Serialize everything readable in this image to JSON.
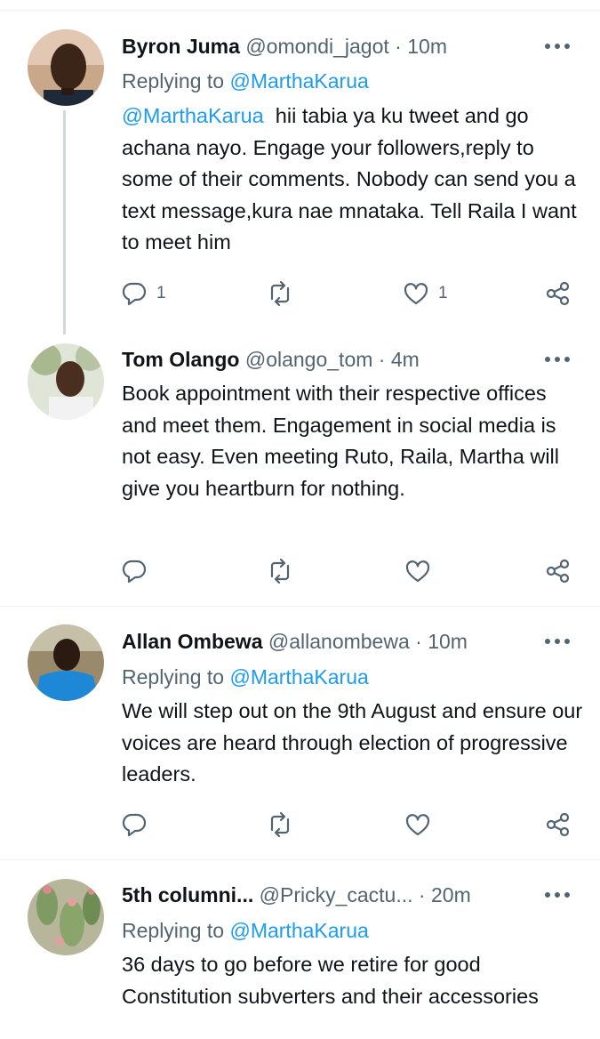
{
  "theme": {
    "accent": "#1d9bf0",
    "muted": "#536471",
    "text": "#0f1419",
    "divider": "#eff3f4"
  },
  "tweets": [
    {
      "name": "Byron Juma",
      "handle": "@omondi_jagot",
      "time": "10m",
      "separator": "·",
      "replying_label": "Replying to",
      "replying_to": "@MarthaKarua",
      "mention": "@MarthaKarua",
      "text": "hii tabia ya ku tweet and go achana nayo. Engage your followers,reply to some of their comments.  Nobody can send you a text message,kura nae mnataka. Tell Raila I want to meet him",
      "reply_count": "1",
      "like_count": "1",
      "icons": [
        "reply-icon",
        "retweet-icon",
        "like-icon",
        "share-icon",
        "more-icon"
      ]
    },
    {
      "name": "Tom Olango",
      "handle": "@olango_tom",
      "time": "4m",
      "separator": "·",
      "text": "Book appointment with their respective offices and meet them. Engagement in social media is not easy. Even meeting Ruto, Raila, Martha will give you heartburn for nothing.",
      "icons": [
        "reply-icon",
        "retweet-icon",
        "like-icon",
        "share-icon",
        "more-icon"
      ]
    },
    {
      "name": "Allan Ombewa",
      "handle": "@allanombewa",
      "time": "10m",
      "separator": "·",
      "replying_label": "Replying to",
      "replying_to": "@MarthaKarua",
      "text": "We will step out on the 9th August and ensure our voices are heard through election of progressive leaders.",
      "icons": [
        "reply-icon",
        "retweet-icon",
        "like-icon",
        "share-icon",
        "more-icon"
      ]
    },
    {
      "name": "5th columni...",
      "handle": "@Pricky_cactu...",
      "time": "20m",
      "separator": "·",
      "replying_label": "Replying to",
      "replying_to": "@MarthaKarua",
      "text": "36 days to go before we retire for good Constitution subverters and their accessories",
      "icons": [
        "more-icon"
      ]
    }
  ]
}
